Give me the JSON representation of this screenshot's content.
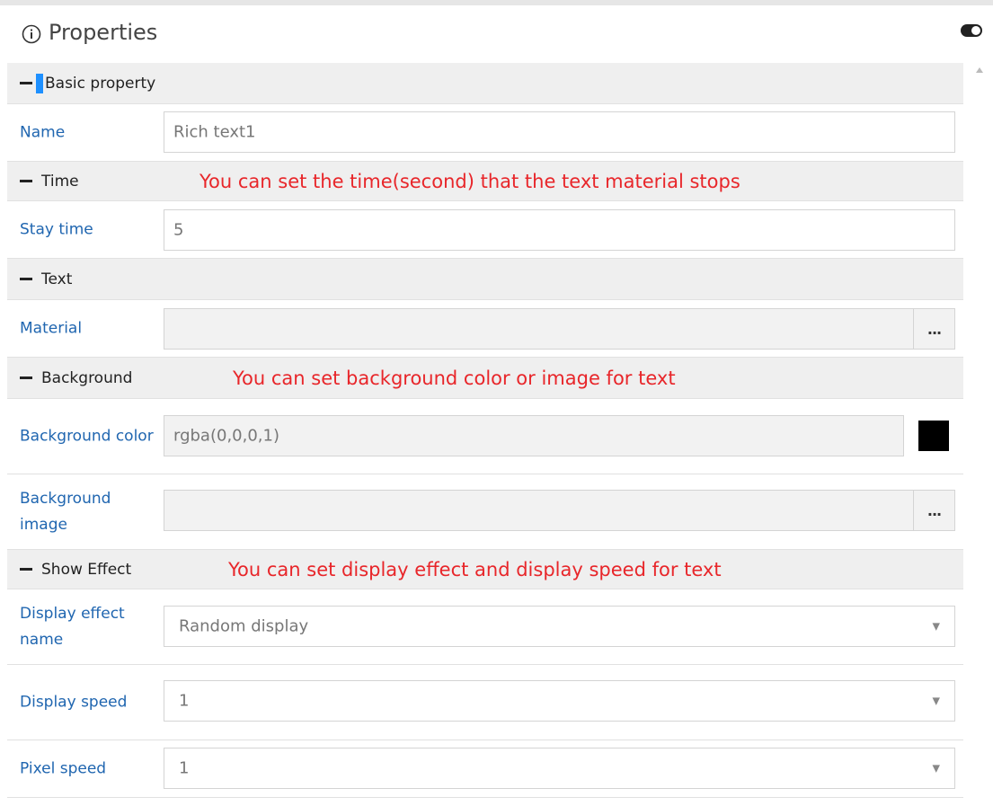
{
  "panel": {
    "title": "Properties",
    "icons": {
      "info": "info-circle-icon",
      "toggle": "toggle-switch-icon",
      "scroll_up": "scroll-up-arrow-icon"
    }
  },
  "sections": {
    "basic": {
      "label": "Basic property"
    },
    "time": {
      "label": "Time",
      "annotation": "You can set the time(second) that the text material stops"
    },
    "text": {
      "label": "Text"
    },
    "background": {
      "label": "Background",
      "annotation": "You can set background color or image for text"
    },
    "effect": {
      "label": "Show Effect",
      "annotation": "You can set display effect and display speed for text"
    }
  },
  "fields": {
    "name": {
      "label": "Name",
      "value": "Rich text1"
    },
    "stay_time": {
      "label": "Stay time",
      "value": "5"
    },
    "material": {
      "label": "Material",
      "value": "",
      "button": "..."
    },
    "bg_color": {
      "label": "Background color",
      "value": "rgba(0,0,0,1)",
      "swatch": "#000000"
    },
    "bg_image": {
      "label": "Background image",
      "value": "",
      "button": "..."
    },
    "effect_name": {
      "label": "Display effect name",
      "value": "Random display"
    },
    "display_speed": {
      "label": "Display speed",
      "value": "1"
    },
    "pixel_speed": {
      "label": "Pixel speed",
      "value": "1"
    }
  },
  "colors": {
    "annotation": "#e8262a",
    "label": "#2066b0",
    "section_bg": "#efefef",
    "accent": "#1e90ff"
  }
}
